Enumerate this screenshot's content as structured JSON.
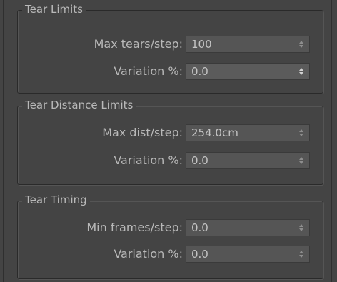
{
  "tear_limits": {
    "title": "Tear Limits",
    "max_tears": {
      "label": "Max tears/step:",
      "value": "100"
    },
    "variation": {
      "label": "Variation %:",
      "value": "0.0"
    }
  },
  "tear_distance": {
    "title": "Tear Distance Limits",
    "max_dist": {
      "label": "Max dist/step:",
      "value": "254.0cm"
    },
    "variation": {
      "label": "Variation %:",
      "value": "0.0"
    }
  },
  "tear_timing": {
    "title": "Tear Timing",
    "min_frames": {
      "label": "Min frames/step:",
      "value": "0.0"
    },
    "variation": {
      "label": "Variation %:",
      "value": "0.0"
    }
  },
  "icons": {
    "spinner_arrows": "spinner-arrows-icon"
  },
  "colors": {
    "panel_bg": "#444444",
    "field_bg": "#555555",
    "text": "#b9b9b9"
  }
}
